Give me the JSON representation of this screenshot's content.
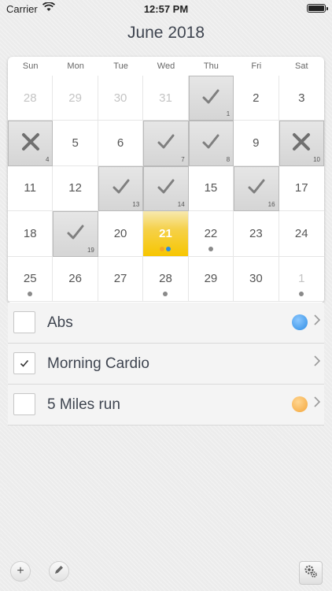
{
  "status_bar": {
    "carrier": "Carrier",
    "time": "12:57 PM",
    "wifi_icon": "wifi-icon",
    "battery_icon": "battery-icon"
  },
  "header": {
    "title": "June 2018"
  },
  "weekdays": [
    "Sun",
    "Mon",
    "Tue",
    "Wed",
    "Thu",
    "Fri",
    "Sat"
  ],
  "calendar_days": [
    {
      "day": "28",
      "muted": true
    },
    {
      "day": "29",
      "muted": true
    },
    {
      "day": "30",
      "muted": true
    },
    {
      "day": "31",
      "muted": true
    },
    {
      "day": "",
      "state": "done",
      "streak": "1"
    },
    {
      "day": "2"
    },
    {
      "day": "3"
    },
    {
      "day": "",
      "state": "miss",
      "streak": "4"
    },
    {
      "day": "5"
    },
    {
      "day": "6"
    },
    {
      "day": "",
      "state": "done",
      "streak": "7"
    },
    {
      "day": "",
      "state": "done",
      "streak": "8"
    },
    {
      "day": "9"
    },
    {
      "day": "",
      "state": "miss",
      "streak": "10"
    },
    {
      "day": "11"
    },
    {
      "day": "12"
    },
    {
      "day": "",
      "state": "done",
      "streak": "13"
    },
    {
      "day": "",
      "state": "done",
      "streak": "14"
    },
    {
      "day": "15"
    },
    {
      "day": "",
      "state": "done",
      "streak": "16"
    },
    {
      "day": "17"
    },
    {
      "day": "18"
    },
    {
      "day": "",
      "state": "done",
      "streak": "19"
    },
    {
      "day": "20"
    },
    {
      "day": "21",
      "today": true,
      "dots": [
        "#f5a623",
        "#2a8de0"
      ]
    },
    {
      "day": "22",
      "dot": true
    },
    {
      "day": "23"
    },
    {
      "day": "24"
    },
    {
      "day": "25",
      "dot": true
    },
    {
      "day": "26"
    },
    {
      "day": "27"
    },
    {
      "day": "28",
      "dot": true
    },
    {
      "day": "29"
    },
    {
      "day": "30"
    },
    {
      "day": "1",
      "muted": true,
      "dot": true
    }
  ],
  "habits": [
    {
      "name": "Abs",
      "checked": false,
      "color": "#2f8de4",
      "color_light": "#8cc8ff"
    },
    {
      "name": "Morning Cardio",
      "checked": true,
      "color": "",
      "color_light": ""
    },
    {
      "name": "5 Miles run",
      "checked": false,
      "color": "#f4a63a",
      "color_light": "#ffd692"
    }
  ],
  "toolbar": {
    "add_label": "+",
    "edit_icon": "pencil-icon",
    "settings_icon": "gear-icon"
  }
}
